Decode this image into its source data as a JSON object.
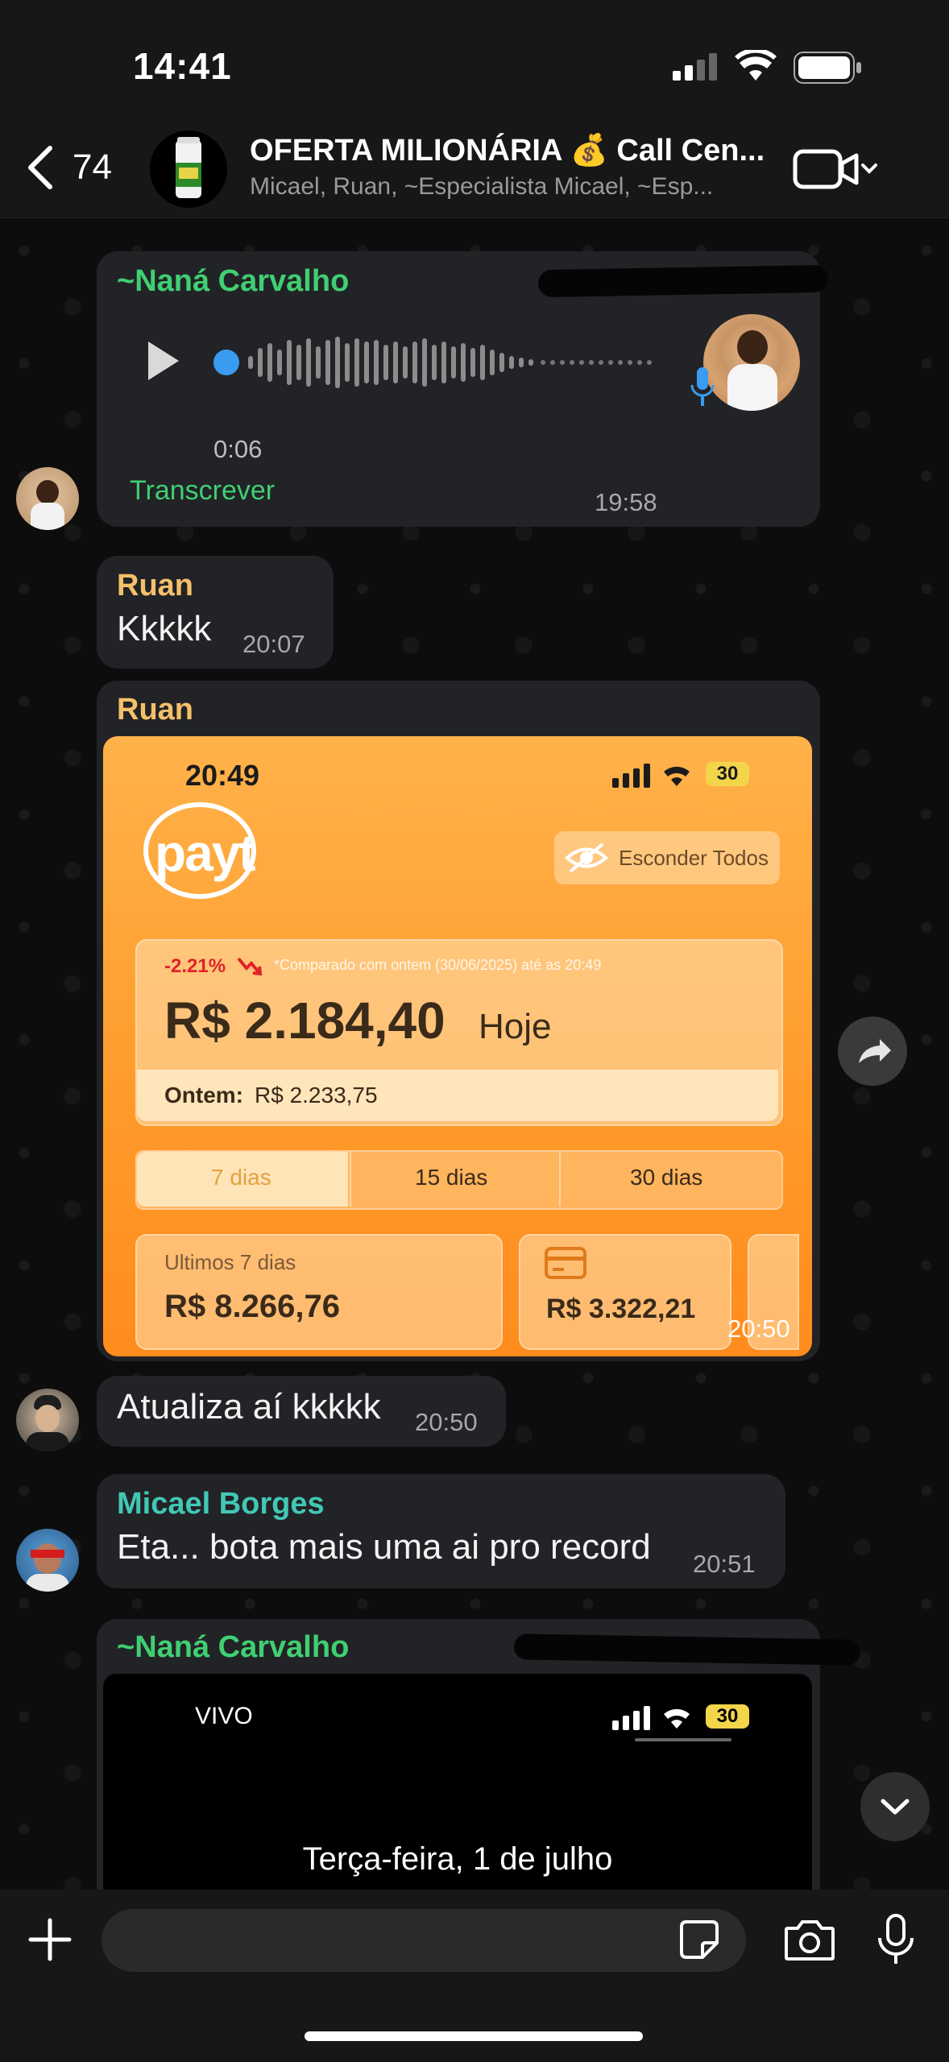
{
  "status_bar": {
    "time": "14:41"
  },
  "header": {
    "back_count": "74",
    "title": "OFERTA MILIONÁRIA 💰 Call Cen...",
    "subtitle": "Micael, Ruan, ~Especialista Micael, ~Esp..."
  },
  "messages": {
    "m1": {
      "sender": "~Naná Carvalho",
      "duration": "0:06",
      "transcribe": "Transcrever",
      "time": "19:58"
    },
    "m2": {
      "sender": "Ruan",
      "text": "Kkkkk",
      "time": "20:07"
    },
    "m3": {
      "sender": "Ruan",
      "time": "20:50"
    },
    "m4": {
      "text": "Atualiza aí kkkkk",
      "time": "20:50"
    },
    "m5": {
      "sender": "Micael Borges",
      "text": "Eta... bota mais uma ai pro record",
      "time": "20:51"
    },
    "m6": {
      "sender": "~Naná Carvalho"
    }
  },
  "payt_screenshot": {
    "time": "20:49",
    "battery": "30",
    "logo": "payt",
    "hide_all": "Esconder Todos",
    "change": "-2.21%",
    "compare_note": "*Comparado com ontem (30/06/2025) até as 20:49",
    "today_value": "R$ 2.184,40",
    "today_label": "Hoje",
    "yesterday_label": "Ontem:",
    "yesterday_value": "R$ 2.233,75",
    "tabs": [
      "7 dias",
      "15 dias",
      "30 dias"
    ],
    "last7_label": "Ultimos 7 dias",
    "last7_value": "R$ 8.266,76",
    "card_value": "R$ 3.322,21"
  },
  "lock_screenshot": {
    "carrier": "VIVO",
    "battery": "30",
    "date": "Terça-feira, 1 de julho"
  },
  "colors": {
    "nana": "#3fcf72",
    "ruan": "#f5c06a",
    "micael": "#41c8b5",
    "accent_blue": "#3a9cf0"
  }
}
